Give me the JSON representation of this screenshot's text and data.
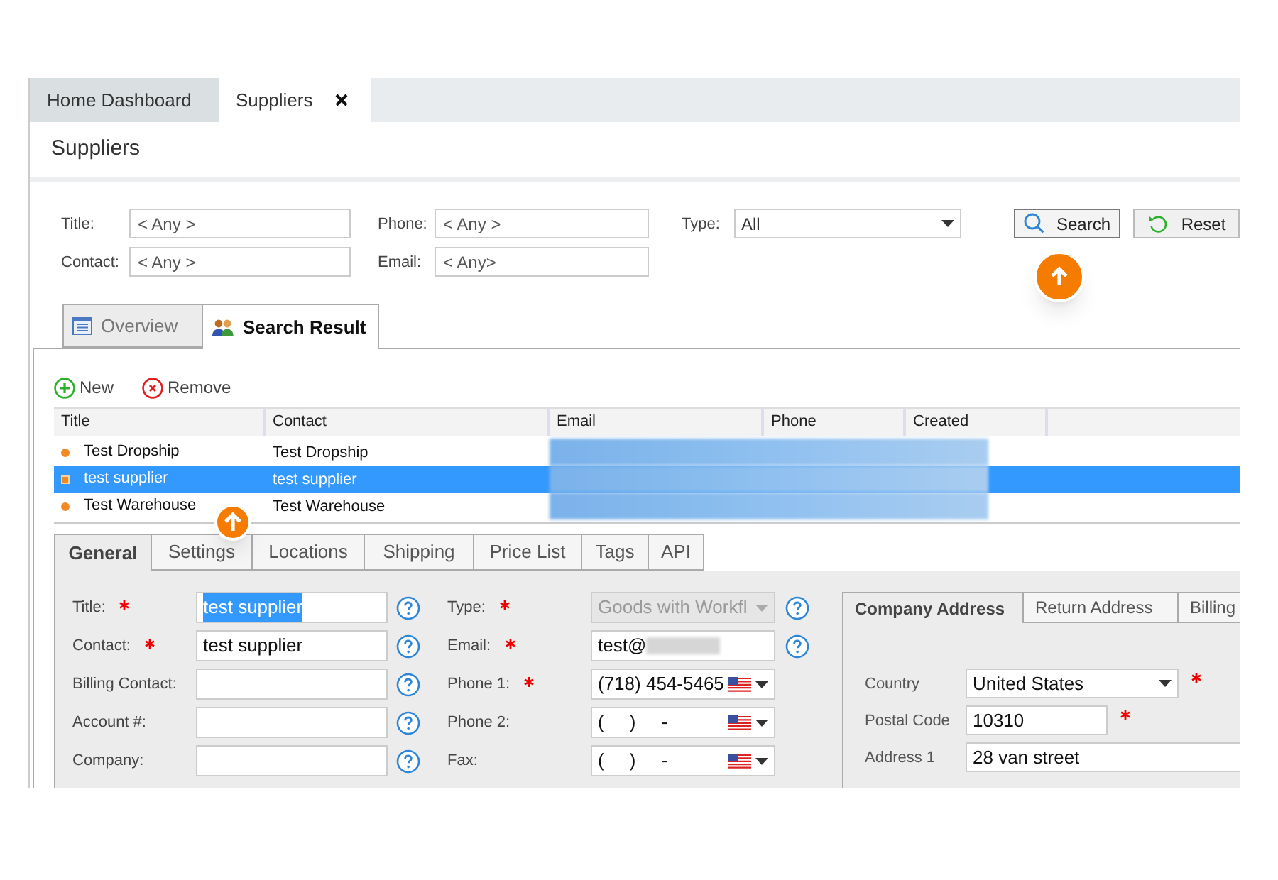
{
  "tabs": [
    {
      "label": "Home Dashboard",
      "selected": false,
      "closable": false
    },
    {
      "label": "Suppliers",
      "selected": true,
      "closable": true
    }
  ],
  "page_title": "Suppliers",
  "filters": [
    {
      "label": "Title:",
      "placeholder": "< Any >"
    },
    {
      "label": "Phone:",
      "placeholder": "< Any >"
    },
    {
      "label": "Contact:",
      "placeholder": "< Any >"
    },
    {
      "label": "Email:",
      "placeholder": "< Any>"
    }
  ],
  "type_filter": {
    "label": "Type:",
    "value": "All"
  },
  "buttons": [
    {
      "kind": "search",
      "label": "Search"
    },
    {
      "kind": "reset",
      "label": "Reset"
    }
  ],
  "result_tabs": [
    {
      "kind": "overview",
      "label": "Overview",
      "selected": false
    },
    {
      "kind": "results",
      "label": "Search Result",
      "selected": true
    }
  ],
  "toolbar": [
    {
      "kind": "new",
      "label": "New"
    },
    {
      "kind": "remove",
      "label": "Remove"
    }
  ],
  "grid": {
    "columns": [
      "Title",
      "Contact",
      "Email",
      "Phone",
      "Created"
    ],
    "rows": [
      {
        "title": "Test Dropship",
        "contact": "Test Dropship",
        "selected": false
      },
      {
        "title": "test supplier",
        "contact": "test supplier",
        "selected": true
      },
      {
        "title": "Test Warehouse",
        "contact": "Test Warehouse",
        "selected": false
      }
    ]
  },
  "detail_tabs": [
    {
      "label": "General",
      "selected": true
    },
    {
      "label": "Settings",
      "selected": false
    },
    {
      "label": "Locations",
      "selected": false
    },
    {
      "label": "Shipping",
      "selected": false
    },
    {
      "label": "Price List",
      "selected": false
    },
    {
      "label": "Tags",
      "selected": false
    },
    {
      "label": "API",
      "selected": false
    }
  ],
  "form_left": [
    {
      "label": "Title:",
      "required": true,
      "value": "test supplier",
      "text_selected": true
    },
    {
      "label": "Contact:",
      "required": true,
      "value": "test supplier",
      "text_selected": false
    },
    {
      "label": "Billing Contact:",
      "required": false
    },
    {
      "label": "Account #:",
      "required": false
    },
    {
      "label": "Company:",
      "required": false
    }
  ],
  "form_middle": [
    {
      "kind": "select",
      "label": "Type:",
      "required": true,
      "value": "Goods with Workfl",
      "disabled": true,
      "help": true
    },
    {
      "kind": "email",
      "label": "Email:",
      "required": true,
      "value": "test@",
      "help": true
    },
    {
      "kind": "phone",
      "label": "Phone 1:",
      "required": true,
      "value": "(718) 454-5465",
      "help": false
    },
    {
      "kind": "phone",
      "label": "Phone 2:",
      "required": false,
      "value": "(     )     -",
      "help": false
    },
    {
      "kind": "phone",
      "label": "Fax:",
      "required": false,
      "value": "(     )     -",
      "help": false
    }
  ],
  "address_tabs": [
    {
      "label": "Company Address",
      "selected": true
    },
    {
      "label": "Return Address",
      "selected": false
    },
    {
      "label": "Billing",
      "selected": false
    }
  ],
  "address_fields": [
    {
      "kind": "select",
      "label": "Country",
      "value": "United States",
      "required": true
    },
    {
      "kind": "text",
      "label": "Postal Code",
      "value": "10310",
      "required": true
    },
    {
      "kind": "wide",
      "label": "Address 1",
      "value": "28 van street",
      "required": false
    }
  ]
}
